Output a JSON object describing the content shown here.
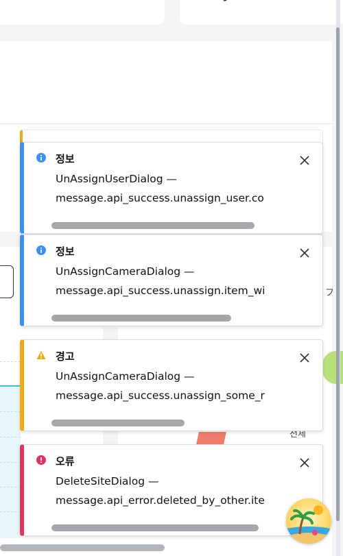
{
  "background": {
    "top_card_text": "y",
    "side_text_1": "フ",
    "side_text_2": "전체"
  },
  "toasts": [
    {
      "type": "info",
      "icon": "info-circle-icon",
      "title": "정보",
      "line1": "UnAssignUserDialog —",
      "line2": "message.api_success.unassign_user.co",
      "progress": 0.8
    },
    {
      "type": "info",
      "icon": "info-circle-icon",
      "title": "정보",
      "line1": "UnAssignCameraDialog —",
      "line2": "message.api_success.unassign.item_wi",
      "progress": 0.7
    },
    {
      "type": "warning",
      "icon": "warning-triangle-icon",
      "title": "경고",
      "line1": "UnAssignCameraDialog —",
      "line2": "message.api_success.unassign_some_r",
      "progress": 0.52
    },
    {
      "type": "error",
      "icon": "error-circle-icon",
      "title": "오류",
      "line1": "DeleteSiteDialog —",
      "line2": "message.api_error.deleted_by_other.ite",
      "progress": 0.81
    }
  ],
  "colors": {
    "info": "#3b8ff6",
    "warning": "#f0a91b",
    "error": "#e0335e",
    "progress": "#a6a7ab"
  }
}
